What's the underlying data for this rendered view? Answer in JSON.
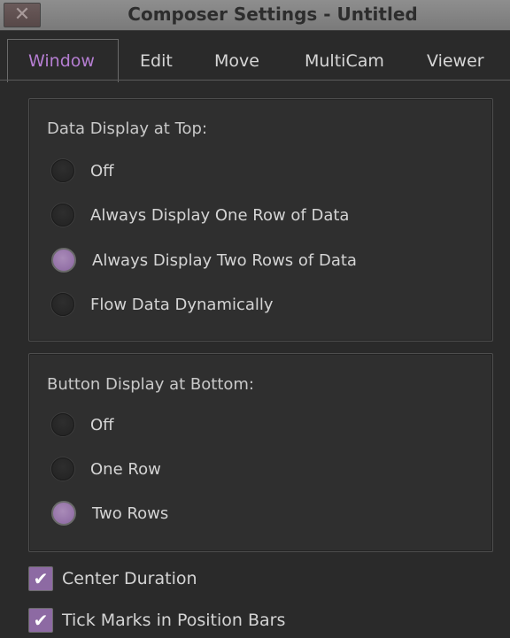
{
  "window": {
    "title": "Composer Settings - Untitled",
    "close_glyph": "✕"
  },
  "tabs": [
    {
      "label": "Window",
      "active": true
    },
    {
      "label": "Edit",
      "active": false
    },
    {
      "label": "Move",
      "active": false
    },
    {
      "label": "MultiCam",
      "active": false
    },
    {
      "label": "Viewer",
      "active": false
    }
  ],
  "data_display": {
    "title": "Data Display at Top:",
    "options": [
      {
        "label": "Off",
        "selected": false
      },
      {
        "label": "Always Display One Row of Data",
        "selected": false
      },
      {
        "label": "Always Display Two Rows of Data",
        "selected": true
      },
      {
        "label": "Flow Data Dynamically",
        "selected": false
      }
    ]
  },
  "button_display": {
    "title": "Button Display at Bottom:",
    "options": [
      {
        "label": "Off",
        "selected": false
      },
      {
        "label": "One Row",
        "selected": false
      },
      {
        "label": "Two Rows",
        "selected": true
      }
    ]
  },
  "checkboxes": [
    {
      "label": "Center Duration",
      "checked": true
    },
    {
      "label": "Tick Marks in Position Bars",
      "checked": true
    }
  ],
  "colors": {
    "accent": "#b57ed2",
    "radio_selected": "#9b77b0",
    "checkbox_fill": "#8d6aa3"
  }
}
